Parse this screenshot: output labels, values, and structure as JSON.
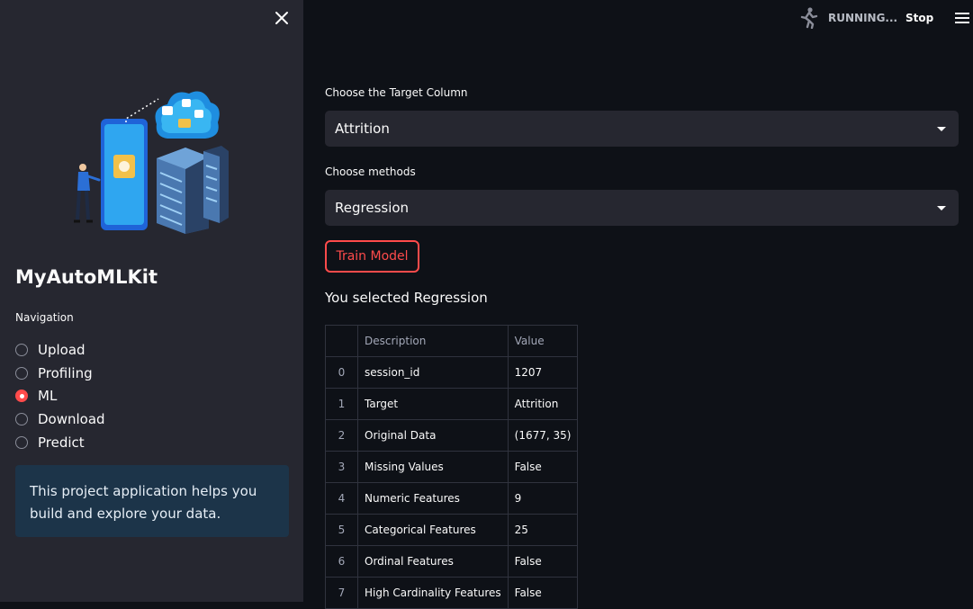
{
  "sidebar": {
    "title": "MyAutoMLKit",
    "nav_label": "Navigation",
    "nav_items": [
      {
        "label": "Upload",
        "selected": false
      },
      {
        "label": "Profiling",
        "selected": false
      },
      {
        "label": "ML",
        "selected": true
      },
      {
        "label": "Download",
        "selected": false
      },
      {
        "label": "Predict",
        "selected": false
      }
    ],
    "info_text": "This project application helps you build and explore your data."
  },
  "header": {
    "status": "RUNNING...",
    "stop_label": "Stop"
  },
  "main": {
    "target_label": "Choose the Target Column",
    "target_value": "Attrition",
    "method_label": "Choose methods",
    "method_value": "Regression",
    "train_button": "Train Model",
    "selected_text": "You selected Regression",
    "table": {
      "headers": [
        "",
        "Description",
        "Value"
      ],
      "rows": [
        {
          "index": "0",
          "description": "session_id",
          "value": "1207"
        },
        {
          "index": "1",
          "description": "Target",
          "value": "Attrition"
        },
        {
          "index": "2",
          "description": "Original Data",
          "value": "(1677, 35)"
        },
        {
          "index": "3",
          "description": "Missing Values",
          "value": "False"
        },
        {
          "index": "4",
          "description": "Numeric Features",
          "value": "9"
        },
        {
          "index": "5",
          "description": "Categorical Features",
          "value": "25"
        },
        {
          "index": "6",
          "description": "Ordinal Features",
          "value": "False"
        },
        {
          "index": "7",
          "description": "High Cardinality Features",
          "value": "False"
        }
      ]
    }
  },
  "colors": {
    "accent": "#ff4b4b",
    "sidebar_bg": "#262730",
    "main_bg": "#0e1117",
    "info_bg": "#1c3449"
  }
}
